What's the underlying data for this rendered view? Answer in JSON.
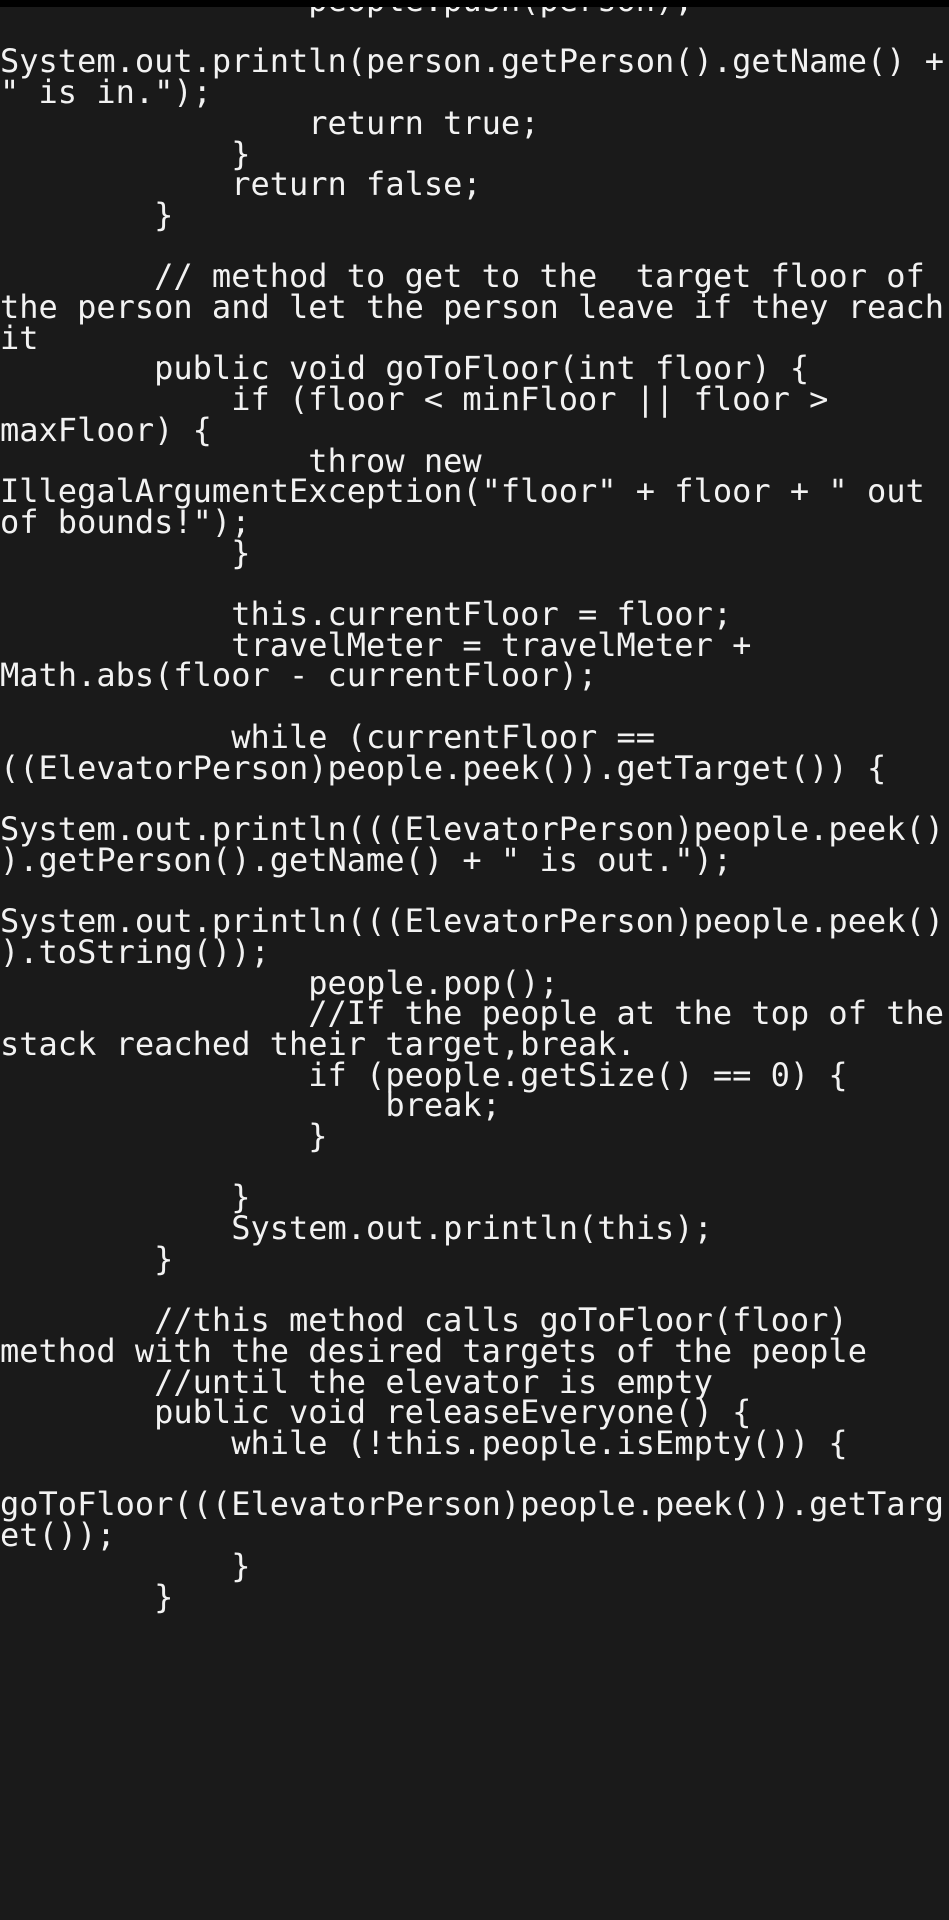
{
  "editor": {
    "kind": "code-viewer",
    "language": "java",
    "theme": {
      "background": "#1a1a1a",
      "top_strip": "#000000",
      "foreground": "#f2f2f2"
    },
    "wrap": true,
    "partial_line_above": "clipped descender of previous line",
    "source": "                people.push(person);\n                System.out.println(person.getPerson().getName() + \" is in.\");\n                return true;\n            }\n            return false;\n        }\n\n        // method to get to the  target floor of the person and let the person leave if they reach it\n        public void goToFloor(int floor) {\n            if (floor < minFloor || floor > maxFloor) {\n                throw new IllegalArgumentException(\"floor\" + floor + \" out of bounds!\");\n            }\n\n            this.currentFloor = floor;\n            travelMeter = travelMeter + Math.abs(floor - currentFloor);\n\n            while (currentFloor == ((ElevatorPerson)people.peek()).getTarget()) {\n                System.out.println(((ElevatorPerson)people.peek()).getPerson().getName() + \" is out.\");\n                System.out.println(((ElevatorPerson)people.peek()).toString());\n                people.pop();\n                //If the people at the top of the stack reached their target,break.\n                if (people.getSize() == 0) {\n                    break;\n                }\n\n            }\n            System.out.println(this);\n        }\n\n        //this method calls goToFloor(floor) method with the desired targets of the people\n        //until the elevator is empty\n        public void releaseEveryone() {\n            while (!this.people.isEmpty()) {\n                goToFloor(((ElevatorPerson)people.peek()).getTarget());\n            }\n        }"
  }
}
